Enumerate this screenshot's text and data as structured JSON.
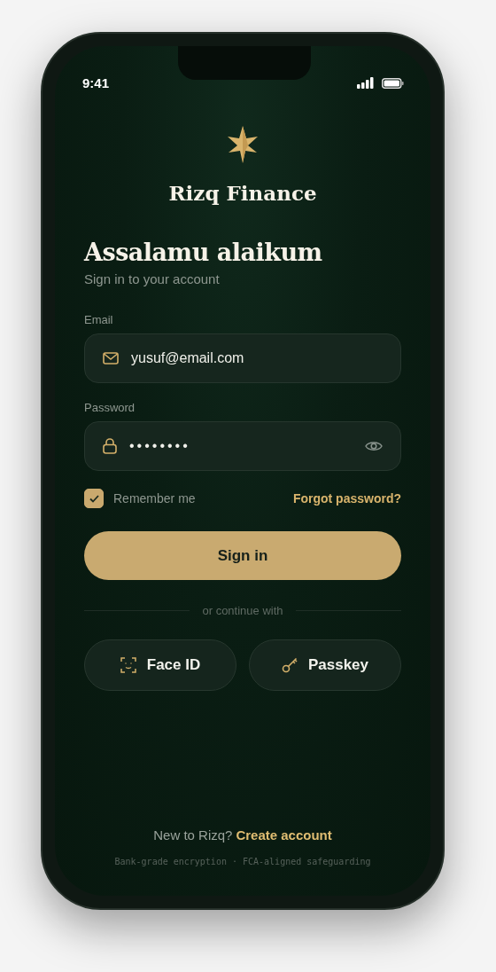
{
  "status_bar": {
    "time": "9:41"
  },
  "brand": {
    "name": "Rizq Finance"
  },
  "greeting": {
    "title": "Assalamu alaikum",
    "subtitle": "Sign in to your account"
  },
  "email": {
    "label": "Email",
    "value": "yusuf@email.com"
  },
  "password": {
    "label": "Password",
    "value": "••••••••"
  },
  "remember": {
    "label": "Remember me",
    "checked": true
  },
  "forgot": "Forgot password?",
  "sign_in": "Sign in",
  "divider": "or continue with",
  "alternatives": [
    {
      "kind": "face",
      "label": "Face ID"
    },
    {
      "kind": "key",
      "label": "Passkey"
    }
  ],
  "signup": {
    "prompt": "New to Rizq?",
    "link": "Create account"
  },
  "footer": "Bank-grade encryption · FCA-aligned safeguarding"
}
